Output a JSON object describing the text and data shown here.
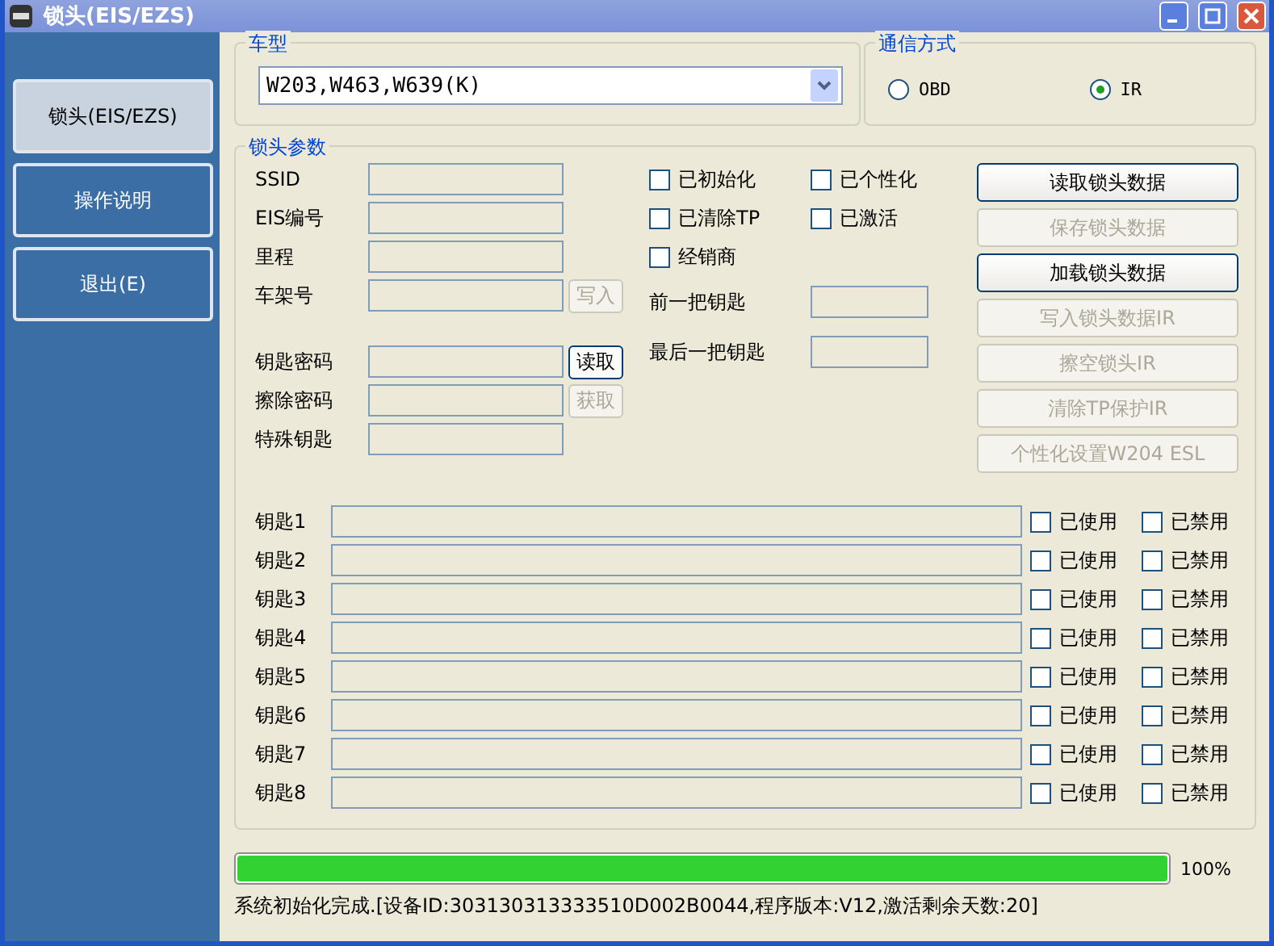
{
  "window": {
    "title": "锁头(EIS/EZS)"
  },
  "sidebar": [
    {
      "label": "锁头(EIS/EZS)",
      "selected": true
    },
    {
      "label": "操作说明",
      "selected": false
    },
    {
      "label": "退出(E)",
      "selected": false
    }
  ],
  "vehicle": {
    "legend": "车型",
    "value": "W203,W463,W639(K)"
  },
  "comm": {
    "legend": "通信方式",
    "options": [
      {
        "label": "OBD",
        "selected": false
      },
      {
        "label": "IR",
        "selected": true
      }
    ]
  },
  "params": {
    "legend": "锁头参数",
    "fields": [
      {
        "label": "SSID"
      },
      {
        "label": "EIS编号"
      },
      {
        "label": "里程"
      },
      {
        "label": "车架号",
        "button": {
          "label": "写入",
          "disabled": true
        }
      }
    ],
    "password_fields": [
      {
        "label": "钥匙密码",
        "button": {
          "label": "读取",
          "disabled": false
        }
      },
      {
        "label": "擦除密码",
        "button": {
          "label": "获取",
          "disabled": true
        }
      },
      {
        "label": "特殊钥匙"
      }
    ],
    "flags": [
      {
        "label": "已初始化",
        "checked": false
      },
      {
        "label": "已个性化",
        "checked": false
      },
      {
        "label": "已清除TP",
        "checked": false
      },
      {
        "label": "已激活",
        "checked": false
      },
      {
        "label": "经销商",
        "checked": false
      }
    ],
    "key_fields": [
      {
        "label": "前一把钥匙"
      },
      {
        "label": "最后一把钥匙"
      }
    ],
    "actions": [
      {
        "label": "读取锁头数据",
        "disabled": false
      },
      {
        "label": "保存锁头数据",
        "disabled": true
      },
      {
        "label": "加载锁头数据",
        "disabled": false
      },
      {
        "label": "写入锁头数据IR",
        "disabled": true
      },
      {
        "label": "擦空锁头IR",
        "disabled": true
      },
      {
        "label": "清除TP保护IR",
        "disabled": true
      },
      {
        "label": "个性化设置W204 ESL",
        "disabled": true
      }
    ],
    "keys": [
      {
        "label": "钥匙1",
        "used": {
          "label": "已使用",
          "checked": false
        },
        "blocked": {
          "label": "已禁用",
          "checked": false
        }
      },
      {
        "label": "钥匙2",
        "used": {
          "label": "已使用",
          "checked": false
        },
        "blocked": {
          "label": "已禁用",
          "checked": false
        }
      },
      {
        "label": "钥匙3",
        "used": {
          "label": "已使用",
          "checked": false
        },
        "blocked": {
          "label": "已禁用",
          "checked": false
        }
      },
      {
        "label": "钥匙4",
        "used": {
          "label": "已使用",
          "checked": false
        },
        "blocked": {
          "label": "已禁用",
          "checked": false
        }
      },
      {
        "label": "钥匙5",
        "used": {
          "label": "已使用",
          "checked": false
        },
        "blocked": {
          "label": "已禁用",
          "checked": false
        }
      },
      {
        "label": "钥匙6",
        "used": {
          "label": "已使用",
          "checked": false
        },
        "blocked": {
          "label": "已禁用",
          "checked": false
        }
      },
      {
        "label": "钥匙7",
        "used": {
          "label": "已使用",
          "checked": false
        },
        "blocked": {
          "label": "已禁用",
          "checked": false
        }
      },
      {
        "label": "钥匙8",
        "used": {
          "label": "已使用",
          "checked": false
        },
        "blocked": {
          "label": "已禁用",
          "checked": false
        }
      }
    ]
  },
  "progress": {
    "level": 1,
    "reading": "100%"
  },
  "status": "系统初始化完成.[设备ID:303130313333510D002B0044,程序版本:V12,激活剩余天数:20]"
}
